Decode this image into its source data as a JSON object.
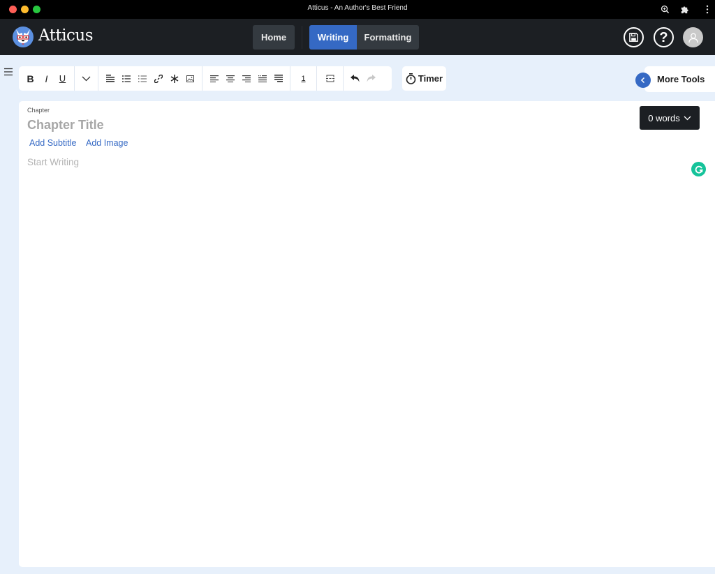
{
  "window": {
    "title": "Atticus - An Author's Best Friend",
    "controls": [
      "close",
      "minimize",
      "maximize"
    ],
    "titlebar_icons": [
      "zoom-icon",
      "extension-icon",
      "more-vertical-icon"
    ]
  },
  "header": {
    "brand": "Atticus",
    "nav": {
      "home": "Home",
      "writing": "Writing",
      "formatting": "Formatting",
      "active": "Writing"
    },
    "actions": [
      "save-icon",
      "help-icon",
      "user-avatar-icon"
    ],
    "help_glyph": "?"
  },
  "toolbar": {
    "groups": [
      [
        "bold",
        "italic",
        "underline"
      ],
      [
        "more-dropdown"
      ],
      [
        "heading",
        "bullet-list",
        "numbered-list",
        "link",
        "asterisk",
        "image"
      ],
      [
        "align-left",
        "align-center",
        "align-right",
        "indent",
        "justify"
      ],
      [
        "footnote"
      ],
      [
        "page-break"
      ],
      [
        "undo",
        "redo"
      ]
    ],
    "bold_glyph": "B",
    "italic_glyph": "I",
    "underline_glyph": "U",
    "footnote_glyph": "1",
    "timer_label": "Timer",
    "more_tools_label": "More Tools"
  },
  "editor": {
    "chapter_label": "Chapter",
    "title_placeholder": "Chapter Title",
    "add_subtitle": "Add Subtitle",
    "add_image": "Add Image",
    "body_placeholder": "Start Writing",
    "word_count_label": "0 words"
  },
  "colors": {
    "accent": "#3569c4",
    "header_bg": "#1c1f23",
    "page_bg": "#e7f0fb",
    "grammarly": "#15c39a"
  }
}
